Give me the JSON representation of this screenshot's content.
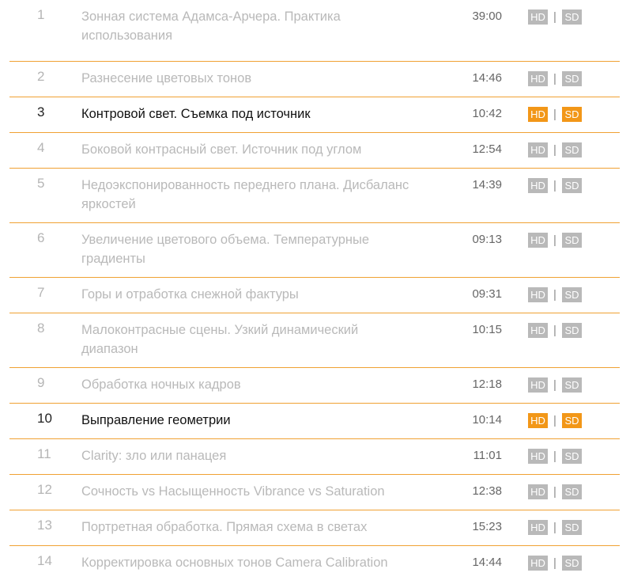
{
  "lessons": [
    {
      "num": "1",
      "title": "Зонная система Адамса-Арчера. Практика использования",
      "duration": "39:00",
      "hd": "HD",
      "sd": "SD",
      "sep": "|",
      "active": false
    },
    {
      "num": "2",
      "title": "Разнесение цветовых тонов",
      "duration": "14:46",
      "hd": "HD",
      "sd": "SD",
      "sep": "|",
      "active": false
    },
    {
      "num": "3",
      "title": "Контровой свет. Съемка под источник",
      "duration": "10:42",
      "hd": "HD",
      "sd": "SD",
      "sep": "|",
      "active": true
    },
    {
      "num": "4",
      "title": "Боковой контрасный свет. Источник под углом",
      "duration": "12:54",
      "hd": "HD",
      "sd": "SD",
      "sep": "|",
      "active": false
    },
    {
      "num": "5",
      "title": "Недоэкспонированность переднего плана. Дисбаланс яркостей",
      "duration": "14:39",
      "hd": "HD",
      "sd": "SD",
      "sep": "|",
      "active": false
    },
    {
      "num": "6",
      "title": "Увеличение цветового объема. Температурные градиенты",
      "duration": "09:13",
      "hd": "HD",
      "sd": "SD",
      "sep": "|",
      "active": false
    },
    {
      "num": "7",
      "title": "Горы и отработка снежной фактуры",
      "duration": "09:31",
      "hd": "HD",
      "sd": "SD",
      "sep": "|",
      "active": false
    },
    {
      "num": "8",
      "title": "Малоконтрасные сцены. Узкий динамический диапазон",
      "duration": "10:15",
      "hd": "HD",
      "sd": "SD",
      "sep": "|",
      "active": false
    },
    {
      "num": "9",
      "title": "Обработка ночных кадров",
      "duration": "12:18",
      "hd": "HD",
      "sd": "SD",
      "sep": "|",
      "active": false
    },
    {
      "num": "10",
      "title": "Выправление геометрии",
      "duration": "10:14",
      "hd": "HD",
      "sd": "SD",
      "sep": "|",
      "active": true
    },
    {
      "num": "11",
      "title": "Clarity: зло или панацея",
      "duration": "11:01",
      "hd": "HD",
      "sd": "SD",
      "sep": "|",
      "active": false
    },
    {
      "num": "12",
      "title": "Сочность vs Насыщенность Vibrance vs Saturation",
      "duration": "12:38",
      "hd": "HD",
      "sd": "SD",
      "sep": "|",
      "active": false
    },
    {
      "num": "13",
      "title": "Портретная обработка. Прямая схема в светах",
      "duration": "15:23",
      "hd": "HD",
      "sd": "SD",
      "sep": "|",
      "active": false
    },
    {
      "num": "14",
      "title": "Корректировка основных тонов Camera Calibration",
      "duration": "14:44",
      "hd": "HD",
      "sd": "SD",
      "sep": "|",
      "active": false
    }
  ],
  "colors": {
    "accent": "#f29718",
    "divider": "#f0a133",
    "inactive_text": "#b9b9b9",
    "active_text": "#111111"
  }
}
